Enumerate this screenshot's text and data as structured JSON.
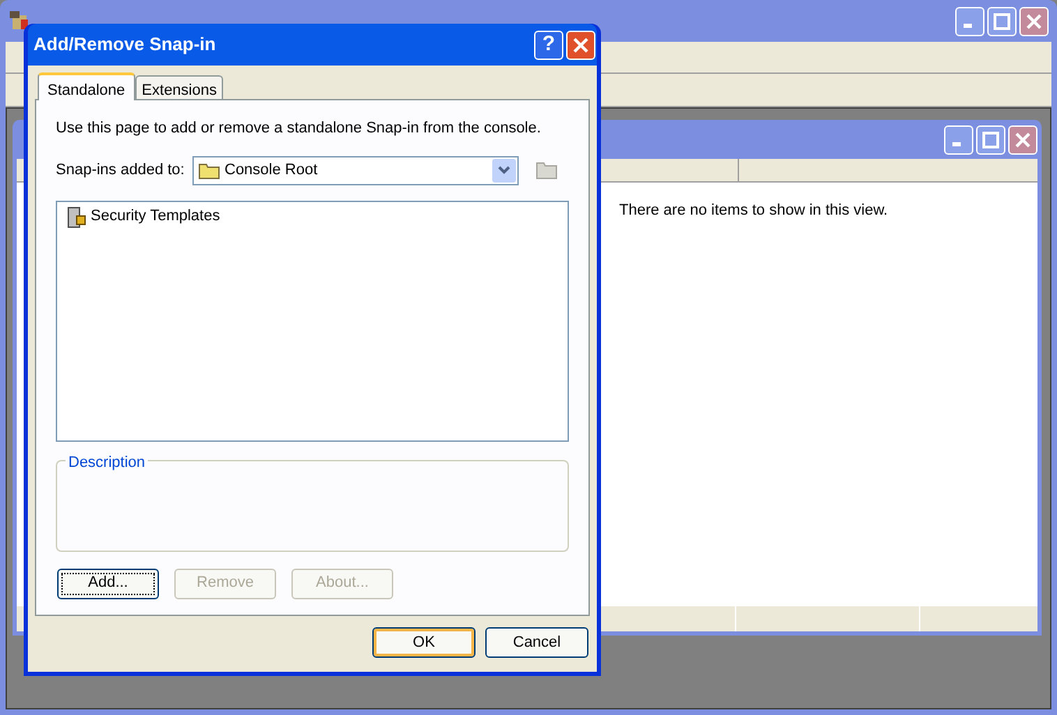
{
  "console": {
    "message": "There are no items to show in this view."
  },
  "dialog": {
    "title": "Add/Remove Snap-in",
    "help": "?",
    "tabs": [
      {
        "label": "Standalone",
        "selected": true
      },
      {
        "label": "Extensions",
        "selected": false
      }
    ],
    "intro": "Use this page to add or remove a standalone Snap-in from the console.",
    "snapins_label": "Snap-ins added to:",
    "snapins_value": "Console Root",
    "snapins": [
      {
        "name": "Security Templates"
      }
    ],
    "description_label": "Description",
    "actions": [
      {
        "label": "Add...",
        "disabled": false,
        "focused": true
      },
      {
        "label": "Remove",
        "disabled": true,
        "focused": false
      },
      {
        "label": "About...",
        "disabled": true,
        "focused": false
      }
    ],
    "buttons": [
      {
        "label": "OK",
        "default": true
      },
      {
        "label": "Cancel",
        "default": false
      }
    ]
  }
}
